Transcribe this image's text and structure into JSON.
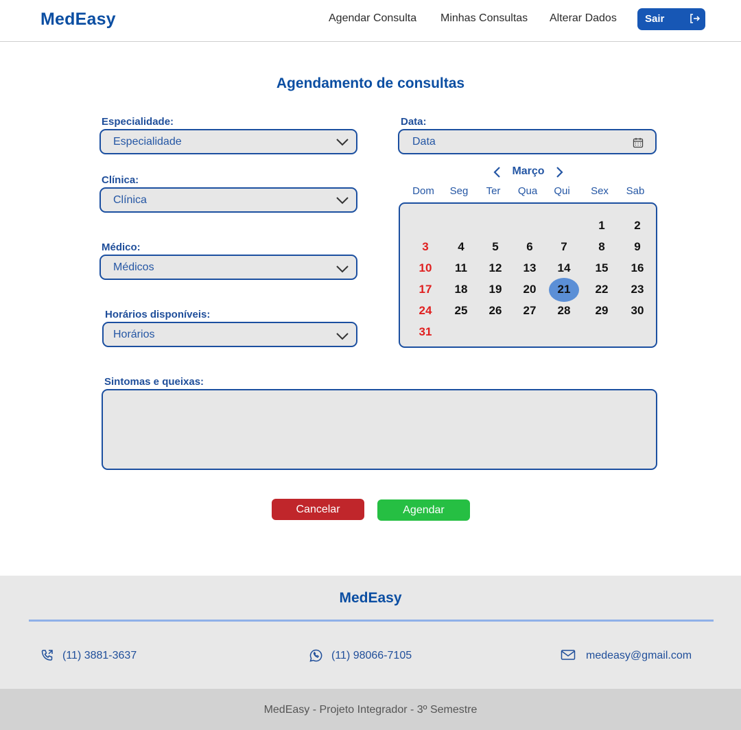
{
  "header": {
    "logo": "MedEasy",
    "nav": [
      "Agendar Consulta",
      "Minhas Consultas",
      "Alterar Dados"
    ],
    "logout_label": "Sair"
  },
  "page_title": "Agendamento de consultas",
  "form": {
    "especialidade": {
      "label": "Especialidade:",
      "value": "Especialidade"
    },
    "clinica": {
      "label": "Clínica:",
      "value": "Clínica"
    },
    "medico": {
      "label": "Médico:",
      "value": "Médicos"
    },
    "horarios": {
      "label": "Horários disponíveis:",
      "value": "Horários"
    },
    "data": {
      "label": "Data:",
      "placeholder": "Data"
    },
    "sintomas": {
      "label": "Sintomas e queixas:",
      "value": ""
    }
  },
  "calendar": {
    "month": "Março",
    "weekdays": [
      "Dom",
      "Seg",
      "Ter",
      "Qua",
      "Qui",
      "Sex",
      "Sab"
    ],
    "start_weekday_index": 5,
    "days_in_month": 31,
    "selected_day": 21
  },
  "buttons": {
    "cancel": "Cancelar",
    "submit": "Agendar"
  },
  "footer": {
    "logo": "MedEasy",
    "phone": "(11) 3881-3637",
    "whatsapp": "(11) 98066-7105",
    "email": "medeasy@gmail.com",
    "credits": "MedEasy - Projeto Integrador - 3º Semestre"
  },
  "colors": {
    "brand": "#0b4ea2",
    "sunday": "#e02020",
    "selected": "#5b8fd6",
    "cancel": "#c0262b",
    "submit": "#26bf43"
  }
}
